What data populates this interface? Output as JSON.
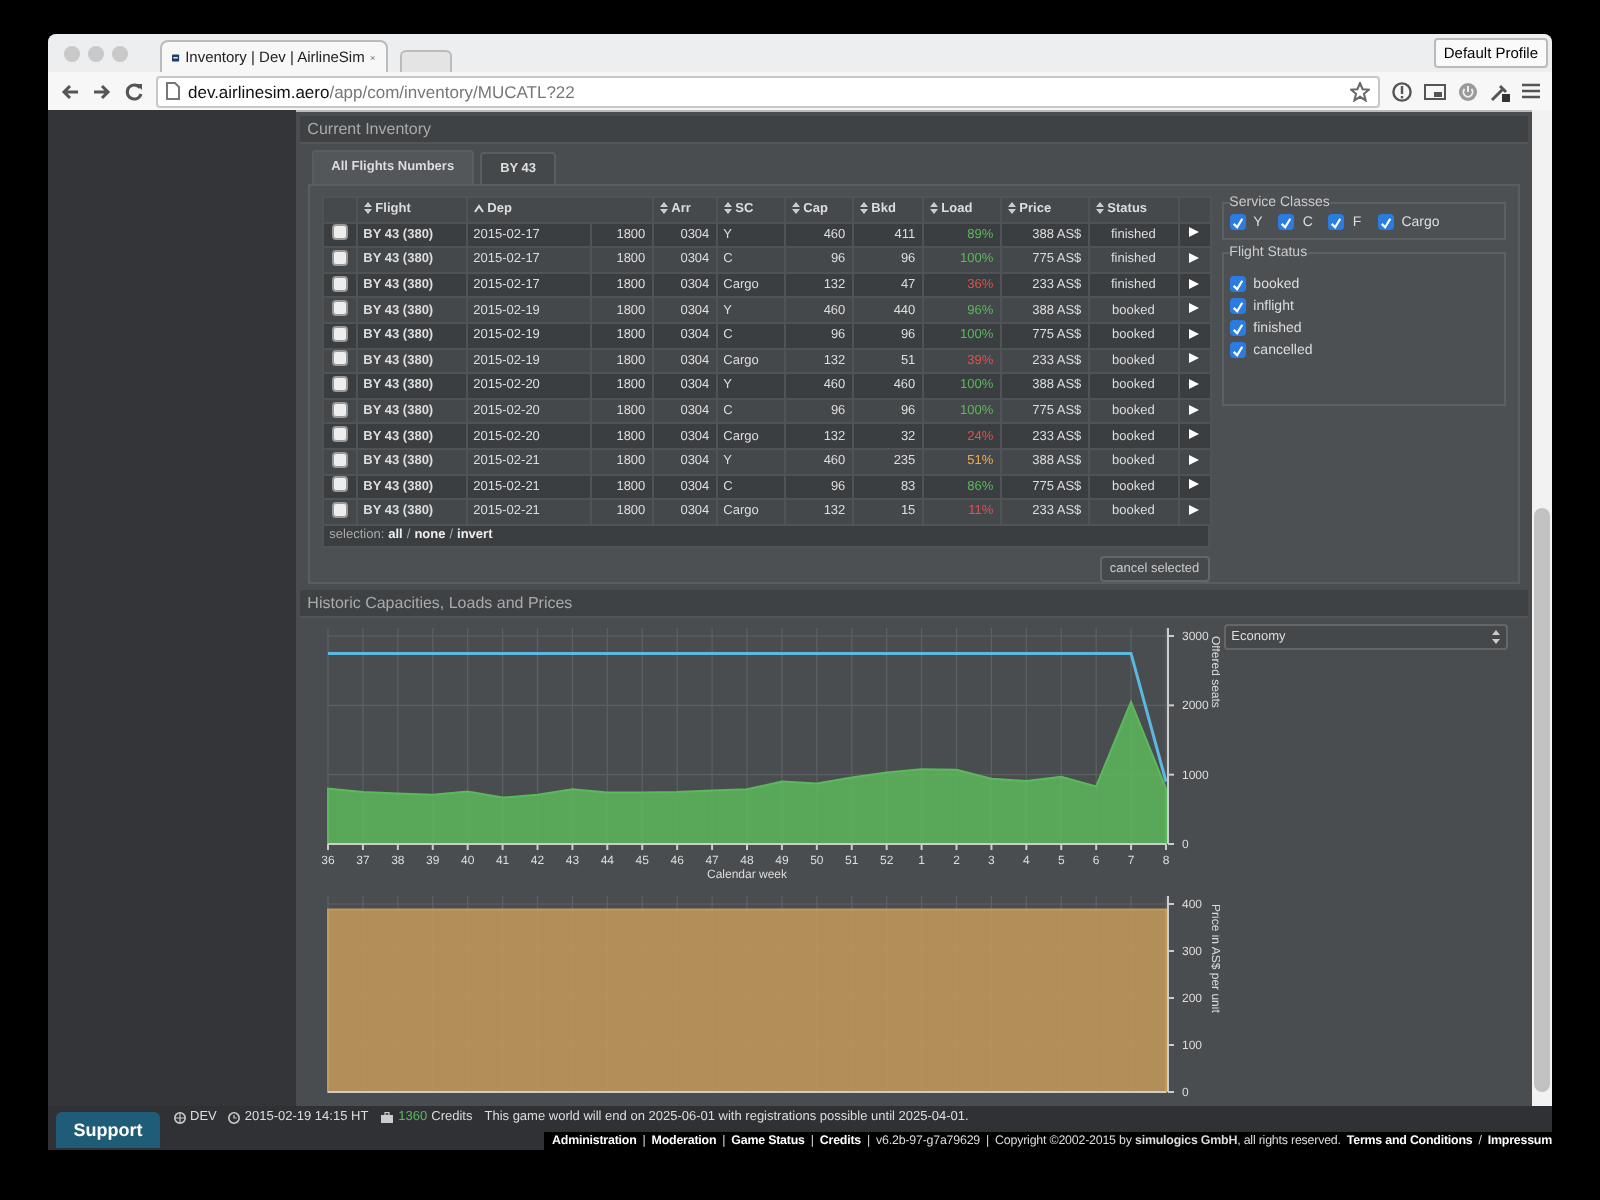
{
  "browser": {
    "tab_title": "Inventory | Dev | AirlineSim",
    "url_domain": "dev.airlinesim.aero",
    "url_path": "/app/com/inventory/MUCATL?22",
    "profile_button": "Default Profile"
  },
  "inventory": {
    "title": "Current Inventory",
    "tabs": [
      {
        "label": "All Flights Numbers",
        "selected": true
      },
      {
        "label": "BY 43",
        "selected": false
      }
    ],
    "table": {
      "columns": [
        {
          "label": "Flight",
          "sorted": false
        },
        {
          "label": "Dep",
          "sorted": true
        },
        {
          "label": "Arr",
          "sorted": false
        },
        {
          "label": "SC",
          "sorted": false
        },
        {
          "label": "Cap",
          "sorted": false
        },
        {
          "label": "Bkd",
          "sorted": false
        },
        {
          "label": "Load",
          "sorted": false
        },
        {
          "label": "Price",
          "sorted": false
        },
        {
          "label": "Status",
          "sorted": false
        }
      ],
      "rows": [
        {
          "checked": false,
          "flight": "BY 43 (380)",
          "dep_date": "2015-02-17",
          "dep_time": "1800",
          "arr": "0304",
          "sc": "Y",
          "cap": "460",
          "bkd": "411",
          "load": "89%",
          "color": "#5cb85c",
          "price": "388 AS$",
          "status": "finished"
        },
        {
          "checked": false,
          "flight": "BY 43 (380)",
          "dep_date": "2015-02-17",
          "dep_time": "1800",
          "arr": "0304",
          "sc": "C",
          "cap": "96",
          "bkd": "96",
          "load": "100%",
          "color": "#5cb85c",
          "price": "775 AS$",
          "status": "finished"
        },
        {
          "checked": false,
          "flight": "BY 43 (380)",
          "dep_date": "2015-02-17",
          "dep_time": "1800",
          "arr": "0304",
          "sc": "Cargo",
          "cap": "132",
          "bkd": "47",
          "load": "36%",
          "color": "#d9534f",
          "price": "233 AS$",
          "status": "finished"
        },
        {
          "checked": false,
          "flight": "BY 43 (380)",
          "dep_date": "2015-02-19",
          "dep_time": "1800",
          "arr": "0304",
          "sc": "Y",
          "cap": "460",
          "bkd": "440",
          "load": "96%",
          "color": "#5cb85c",
          "price": "388 AS$",
          "status": "booked"
        },
        {
          "checked": false,
          "flight": "BY 43 (380)",
          "dep_date": "2015-02-19",
          "dep_time": "1800",
          "arr": "0304",
          "sc": "C",
          "cap": "96",
          "bkd": "96",
          "load": "100%",
          "color": "#5cb85c",
          "price": "775 AS$",
          "status": "booked"
        },
        {
          "checked": false,
          "flight": "BY 43 (380)",
          "dep_date": "2015-02-19",
          "dep_time": "1800",
          "arr": "0304",
          "sc": "Cargo",
          "cap": "132",
          "bkd": "51",
          "load": "39%",
          "color": "#d9534f",
          "price": "233 AS$",
          "status": "booked"
        },
        {
          "checked": false,
          "flight": "BY 43 (380)",
          "dep_date": "2015-02-20",
          "dep_time": "1800",
          "arr": "0304",
          "sc": "Y",
          "cap": "460",
          "bkd": "460",
          "load": "100%",
          "color": "#5cb85c",
          "price": "388 AS$",
          "status": "booked"
        },
        {
          "checked": false,
          "flight": "BY 43 (380)",
          "dep_date": "2015-02-20",
          "dep_time": "1800",
          "arr": "0304",
          "sc": "C",
          "cap": "96",
          "bkd": "96",
          "load": "100%",
          "color": "#5cb85c",
          "price": "775 AS$",
          "status": "booked"
        },
        {
          "checked": false,
          "flight": "BY 43 (380)",
          "dep_date": "2015-02-20",
          "dep_time": "1800",
          "arr": "0304",
          "sc": "Cargo",
          "cap": "132",
          "bkd": "32",
          "load": "24%",
          "color": "#d9534f",
          "price": "233 AS$",
          "status": "booked"
        },
        {
          "checked": false,
          "flight": "BY 43 (380)",
          "dep_date": "2015-02-21",
          "dep_time": "1800",
          "arr": "0304",
          "sc": "Y",
          "cap": "460",
          "bkd": "235",
          "load": "51%",
          "color": "#f0ad4e",
          "price": "388 AS$",
          "status": "booked"
        },
        {
          "checked": false,
          "flight": "BY 43 (380)",
          "dep_date": "2015-02-21",
          "dep_time": "1800",
          "arr": "0304",
          "sc": "C",
          "cap": "96",
          "bkd": "83",
          "load": "86%",
          "color": "#5cb85c",
          "price": "775 AS$",
          "status": "booked"
        },
        {
          "checked": false,
          "flight": "BY 43 (380)",
          "dep_date": "2015-02-21",
          "dep_time": "1800",
          "arr": "0304",
          "sc": "Cargo",
          "cap": "132",
          "bkd": "15",
          "load": "11%",
          "color": "#d9534f",
          "price": "233 AS$",
          "status": "booked"
        }
      ],
      "selection": {
        "label": "selection:",
        "links": [
          "all",
          "none",
          "invert"
        ],
        "separator": "/"
      }
    },
    "cancel_button": "cancel selected",
    "filters": {
      "service_classes": {
        "title": "Service Classes",
        "items": [
          {
            "label": "Y",
            "checked": true
          },
          {
            "label": "C",
            "checked": true
          },
          {
            "label": "F",
            "checked": true
          },
          {
            "label": "Cargo",
            "checked": true
          }
        ]
      },
      "flight_status": {
        "title": "Flight Status",
        "items": [
          {
            "label": "booked",
            "checked": true
          },
          {
            "label": "inflight",
            "checked": true
          },
          {
            "label": "finished",
            "checked": true
          },
          {
            "label": "cancelled",
            "checked": true
          }
        ]
      }
    }
  },
  "history": {
    "title": "Historic Capacities, Loads and Prices",
    "class_select": "Economy",
    "capacity_chart": {
      "chart_data": {
        "type": "area",
        "xlabel": "Calendar week",
        "ylabel": "Offered seats",
        "categories": [
          "36",
          "37",
          "38",
          "39",
          "40",
          "41",
          "42",
          "43",
          "44",
          "45",
          "46",
          "47",
          "48",
          "49",
          "50",
          "51",
          "52",
          "1",
          "2",
          "3",
          "4",
          "5",
          "6",
          "7",
          "8"
        ],
        "ylim": [
          0,
          3000
        ],
        "yticks": [
          0,
          1000,
          2000,
          3000
        ],
        "grid": true,
        "series": [
          {
            "type": "line",
            "color": "#5bb8e0",
            "values": [
              2750,
              2750,
              2750,
              2750,
              2750,
              2750,
              2750,
              2750,
              2750,
              2750,
              2750,
              2750,
              2750,
              2750,
              2750,
              2750,
              2750,
              2750,
              2750,
              2750,
              2750,
              2750,
              2750,
              2750,
              900
            ]
          },
          {
            "color": "#5cb85c",
            "values": [
              800,
              750,
              730,
              710,
              760,
              670,
              710,
              790,
              740,
              740,
              750,
              770,
              790,
              900,
              870,
              960,
              1030,
              1080,
              1070,
              940,
              910,
              970,
              830,
              2050,
              800
            ]
          }
        ]
      }
    },
    "price_chart": {
      "chart_data": {
        "type": "area",
        "ylabel": "Price in AS$ per unit",
        "ylim": [
          0,
          400
        ],
        "yticks": [
          0,
          100,
          200,
          300,
          400
        ],
        "grid": true,
        "series": [
          {
            "color": "#c49a5a",
            "values": [
              388,
              388,
              388,
              388,
              388,
              388,
              388,
              388,
              388,
              388,
              388,
              388,
              388,
              388,
              388,
              388,
              388,
              388,
              388,
              388,
              388,
              388,
              388,
              388,
              388
            ]
          }
        ]
      }
    }
  },
  "footer": {
    "support_button": "Support",
    "env": "DEV",
    "datetime": "2015-02-19 14:15 HT",
    "credits_amount": "1360",
    "credits_label": "Credits",
    "notice": "This game world will end on 2025-06-01 with registrations possible until 2025-04-01.",
    "links_line": [
      {
        "kind": "link",
        "text": "Administration"
      },
      {
        "kind": "sep",
        "text": "|"
      },
      {
        "kind": "link",
        "text": "Moderation"
      },
      {
        "kind": "sep",
        "text": "|"
      },
      {
        "kind": "link",
        "text": "Game Status"
      },
      {
        "kind": "sep",
        "text": "|"
      },
      {
        "kind": "link",
        "text": "Credits"
      },
      {
        "kind": "sep",
        "text": "|"
      },
      {
        "kind": "text",
        "text": "v6.2b-97-g7a79629"
      },
      {
        "kind": "sep",
        "text": "|"
      },
      {
        "kind": "text",
        "text": "Copyright ©2002-2015 by **simulogics GmbH**, all rights reserved."
      },
      {
        "kind": "link",
        "text": "Terms and Conditions"
      },
      {
        "kind": "sep",
        "text": "/"
      },
      {
        "kind": "link",
        "text": "Impressum"
      }
    ]
  }
}
